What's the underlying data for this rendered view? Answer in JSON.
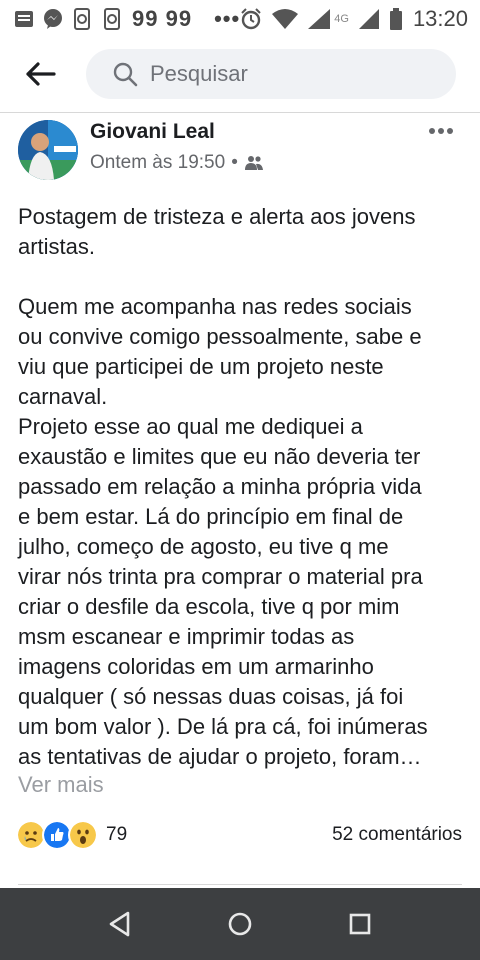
{
  "status_bar": {
    "left_number": "99 99",
    "dots": "•••",
    "network": "4G",
    "time": "13:20"
  },
  "header": {
    "search_placeholder": "Pesquisar"
  },
  "post": {
    "author": "Giovani Leal",
    "timestamp": "Ontem às 19:50",
    "separator": "•",
    "audience_icon": "friends-icon",
    "lines": [
      "Postagem de tristeza e alerta aos jovens",
      "artistas.",
      "",
      "Quem me acompanha nas redes sociais",
      "ou convive comigo pessoalmente, sabe e",
      "viu que participei de um projeto neste",
      "carnaval.",
      "Projeto esse ao qual me dediquei a",
      "exaustão e limites que eu não deveria ter",
      "passado em relação a minha própria vida",
      "e bem estar. Lá do princípio em final de",
      "julho, começo de agosto, eu tive q me",
      "virar nós trinta pra comprar o material pra",
      "criar o desfile da escola, tive q por mim",
      "msm escanear e imprimir todas as",
      "imagens coloridas em um armarinho",
      "qualquer ( só nessas duas coisas, já foi",
      "um bom valor ). De lá pra cá, foi inúmeras",
      "as tentativas de ajudar o projeto, foram…"
    ],
    "see_more": "Ver mais",
    "reaction_count": "79",
    "comments": "52 comentários"
  },
  "colors": {
    "text": "#1c1e21",
    "secondary": "#65676b",
    "like_blue": "#1877f2",
    "nav_bg": "#3d3f41"
  }
}
